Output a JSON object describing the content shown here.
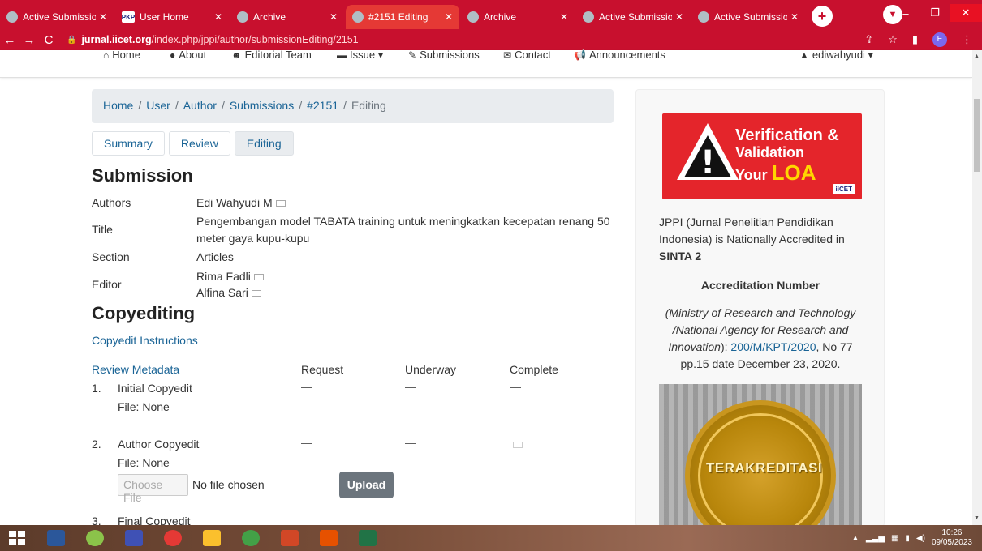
{
  "browser": {
    "tabs": [
      {
        "label": "Active Submission",
        "favicon": "globe",
        "active": false
      },
      {
        "label": "User Home",
        "favicon": "PKP",
        "active": false
      },
      {
        "label": "Archive",
        "favicon": "globe",
        "active": false
      },
      {
        "label": "#2151 Editing",
        "favicon": "globe",
        "active": true
      },
      {
        "label": "Archive",
        "favicon": "globe",
        "active": false
      },
      {
        "label": "Active Submission",
        "favicon": "globe",
        "active": false
      },
      {
        "label": "Active Submission",
        "favicon": "globe",
        "active": false
      }
    ],
    "url_domain": "jurnal.iicet.org",
    "url_path": "/index.php/jppi/author/submissionEditing/2151",
    "profile_initial": "E",
    "accent": "#c8102e"
  },
  "sitenav": {
    "items": [
      "Home",
      "About",
      "Editorial Team",
      "Issue",
      "Submissions",
      "Contact",
      "Announcements"
    ],
    "user": "ediwahyudi"
  },
  "breadcrumb": {
    "items": [
      "Home",
      "User",
      "Author",
      "Submissions",
      "#2151"
    ],
    "current": "Editing"
  },
  "page_tabs": [
    "Summary",
    "Review",
    "Editing"
  ],
  "submission": {
    "heading": "Submission",
    "labels": {
      "authors": "Authors",
      "title": "Title",
      "section": "Section",
      "editor": "Editor"
    },
    "authors": "Edi Wahyudi M",
    "title_line1": "Pengembangan model TABATA training untuk meningkatkan kecepatan renang 50",
    "title_line2": "meter gaya kupu-kupu",
    "section": "Articles",
    "editors": [
      "Rima Fadli",
      "Alfina Sari"
    ]
  },
  "copyediting": {
    "heading": "Copyediting",
    "instructions_link": "Copyedit Instructions",
    "review_metadata_link": "Review Metadata",
    "columns": [
      "Request",
      "Underway",
      "Complete"
    ],
    "dash": "—",
    "rows": [
      {
        "num": "1.",
        "name": "Initial Copyedit",
        "file": "File: None"
      },
      {
        "num": "2.",
        "name": "Author Copyedit",
        "file": "File: None"
      },
      {
        "num": "3.",
        "name": "Final Copyedit"
      }
    ],
    "choose_file": "Choose File",
    "no_file": "No file chosen",
    "upload": "Upload"
  },
  "sidebar": {
    "banner_line1": "Verification &",
    "banner_line2": "Validation",
    "banner_your": "Your ",
    "banner_loa": "LOA",
    "banner_logo": "iiCET",
    "accr_line1": "JPPI (Jurnal Penelitian Pendidikan",
    "accr_line2": "Indonesia) is Nationally Accredited in",
    "accr_line3": "SINTA 2",
    "accr_heading": "Accreditation Number",
    "ministry_line1": "(Ministry of Research and Technology",
    "ministry_line2": "/National Agency for Research and",
    "ministry_line3a": "Innovation",
    "ministry_line3b": "): ",
    "ministry_link": "200/M/KPT/2020",
    "ministry_line3c": ", No 77",
    "ministry_line4": "pp.15 date December 23, 2020.",
    "seal_text": "TERAKREDITASI"
  },
  "taskbar": {
    "time": "10:26",
    "date": "09/05/2023"
  }
}
